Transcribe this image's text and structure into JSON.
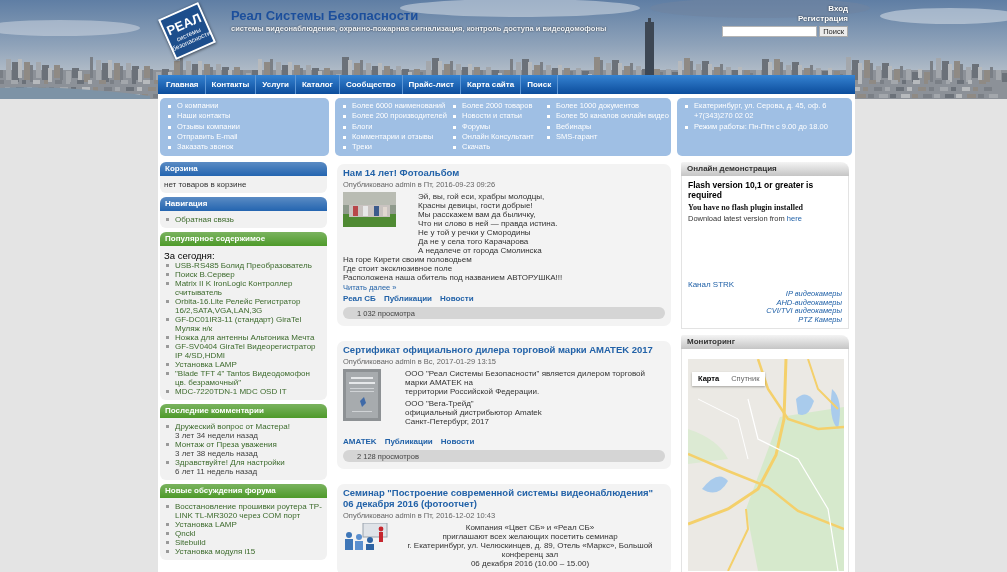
{
  "header": {
    "logo": {
      "text": "РЕАЛ",
      "subtext": "системы безопасности"
    },
    "site_title": "Реал Системы Безопасности",
    "tagline": "системы видеонаблюдения, охранно-пожарная сигнализация, контроль доступа и видеодомофоны",
    "user_links": [
      "Вход",
      "Регистрация"
    ],
    "search": {
      "button": "Поиск"
    }
  },
  "nav": [
    "Главная",
    "Контакты",
    "Услуги",
    "Каталог",
    "Сообщество",
    "Прайс-лист",
    "Карта сайта",
    "Поиск"
  ],
  "info_panels": [
    {
      "columns": [
        [
          "О компании",
          "Наши контакты",
          "Отзывы компании",
          "Отправить E-mail",
          "Заказать звонок"
        ]
      ]
    },
    {
      "columns": [
        [
          "Более 6000 наименований",
          "Более 200 производителей",
          "Блоги",
          "Комментарии и отзывы",
          "Треки"
        ],
        [
          "Более 2000 товаров",
          "Новости и статьи",
          "Форумы",
          "Онлайн Консультант",
          "Скачать"
        ],
        [
          "Более 1000 документов",
          "Более 50 каналов онлайн видео",
          "Вебинары",
          "SMS-гарант"
        ]
      ]
    }
  ],
  "contacts": [
    "Екатеринбург, ул. Серова, д. 45, оф. 6\n+7(343)270 02 02",
    "Режим работы: Пн-Птн с 9.00 до 18.00"
  ],
  "sidebar_blocks": [
    {
      "title": "Корзина",
      "color": "#2465b0",
      "content": [
        {
          "kind": "text",
          "text": "нет товаров в корзине"
        }
      ]
    },
    {
      "title": "Навигация",
      "color": "#2465b0",
      "content": [
        {
          "kind": "list",
          "items": [
            {
              "text": "Обратная связь"
            }
          ]
        }
      ]
    },
    {
      "title": "Популярное содержимое",
      "color": "#4e9a2a",
      "content": [
        {
          "kind": "subtitle",
          "text": "За сегодня:"
        },
        {
          "kind": "list",
          "items": [
            {
              "text": "USB-RS485 Болид Преобразователь"
            },
            {
              "text": "Поиск В.Сервер"
            },
            {
              "text": "Matrix II K IronLogic Контроллер считыватель"
            },
            {
              "text": "Orbita-16.Lite Релейс Регистратор 16/2,SATA,VGA,LAN,3G"
            },
            {
              "text": "GF-DC01IR3-11 (стандарт) GiraTel Муляж н/к"
            },
            {
              "text": "Ножка для антенны Альтоника Мечта"
            },
            {
              "text": "GF-SV0404 GiraTel Видеорегистратор IP 4/SD,HDMI"
            },
            {
              "text": "Установка LAMP"
            },
            {
              "text": "\"Blade TFT 4\" Tantos Видеодомофон цв. безрамочный\""
            },
            {
              "text": "MDC-7220TDN-1 MDC OSD IT"
            }
          ]
        }
      ]
    },
    {
      "title": "Последние комментарии",
      "color": "#4e9a2a",
      "content": [
        {
          "kind": "list",
          "items": [
            {
              "text": "Дружеский вопрос от Мастера!",
              "note": "3 лет 34 недели назад"
            },
            {
              "text": "Монтаж от Преза уважения",
              "note": "3 лет 38 недель назад"
            },
            {
              "text": "Здравствуйте! Для настройки",
              "note": "6 лет 11 недель назад"
            }
          ]
        }
      ]
    },
    {
      "title": "Новые обсуждения форума",
      "color": "#4e9a2a",
      "content": [
        {
          "kind": "list",
          "items": [
            {
              "text": "Восстановление прошивки роутера TP-LINK TL-MR3020 через COM порт"
            },
            {
              "text": "Установка LAMP"
            },
            {
              "text": "Qnckl"
            },
            {
              "text": "Sitebuild"
            },
            {
              "text": "Установка модуля i15"
            }
          ]
        }
      ]
    }
  ],
  "posts": [
    {
      "kind": "photo",
      "title": "Нам 14 лет! Фотоальбом",
      "meta": "Опубликовано admin в Пт, 2016-09-23 09:26",
      "side": [
        [
          "Эй, вы, гой еси, храбры молодцы,",
          "Красны девицы, гости добрые!",
          "Мы расскажем вам да быличку,",
          "Что ни слово в ней — правда истина.",
          "Не у той у речки у Смородины",
          "Да не у села того Карачарова",
          "А недалече от города Смолинска"
        ]
      ],
      "below": [
        "На горе Кирети своим половодьем",
        "Где стоит эксклюзивное поле",
        "Расположена наша обитель под названием АВТОРУШКА!!!"
      ],
      "read_more": "Читать далее »",
      "tags": [
        "Реал СБ",
        "Публикации",
        "Новости"
      ],
      "views": "1 032 просмотра"
    },
    {
      "kind": "certificate",
      "title": "Сертификат официального дилера торговой марки AMATEK 2017",
      "meta": "Опубликовано admin в Вс, 2017-01-29 13:15",
      "side": [
        [
          "ООО \"Реал Системы Безопасности\" является дилером торговой марки AMATEK на",
          "территории Российской Федерации."
        ],
        [
          "ООО \"Вега-Трейд\"",
          "официальный дистрибьютор Amatek",
          "Санкт-Петербург, 2017"
        ]
      ],
      "tags": [
        "AMATEK",
        "Публикации",
        "Новости"
      ],
      "views": "2 128 просмотров"
    },
    {
      "kind": "presentation",
      "title": "Семинар \"Построение современной системы видеонаблюдения\" 06 декабря 2016 (фотоотчет)",
      "meta": "Опубликовано admin в Пт, 2016-12-02 10:43",
      "side": [
        [
          "Компания «Цвет СБ» и «Реал СБ»",
          "приглашают всех желающих посетить семинар",
          "г. Екатеринбург, ул. Челюскинцев, д. 89, Отель «Маркс», Большой конференц зал",
          "06 декабря 2016 (10.00 – 15.00)"
        ]
      ]
    }
  ],
  "right_blocks": [
    {
      "kind": "flash",
      "title": "Онлайн демонстрация",
      "flash": {
        "heading": "Flash version 10,1 or greater is required",
        "subheading": "You have no flash plugin installed",
        "text": "Download latest version from",
        "link": "here"
      },
      "channel_link": "Канал STRK",
      "links": [
        "IP видеокамеры",
        "AHD-видеокамеры",
        "CVI/TVI видеокамеры",
        "PTZ Камеры"
      ]
    },
    {
      "kind": "map",
      "title": "Мониторинг",
      "map_types": [
        {
          "label": "Карта",
          "selected": true
        },
        {
          "label": "Спутник",
          "selected": false
        }
      ]
    }
  ]
}
